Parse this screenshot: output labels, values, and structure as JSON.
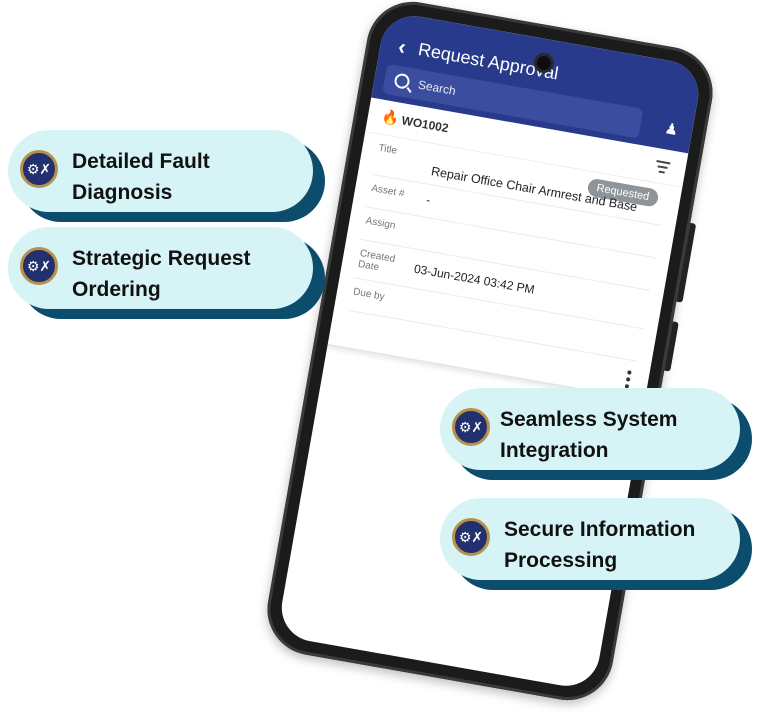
{
  "app": {
    "title": "Request Approval",
    "back_icon": "chevron-left-icon",
    "search_placeholder": "Search",
    "user_icon": "user-approve-icon",
    "filter_icon": "filter-icon"
  },
  "work_order": {
    "priority_icon": "flame-icon",
    "id": "WO1002",
    "status": "Requested",
    "fields": {
      "title_label": "Title",
      "title_value": "Repair Office Chair Armrest and Base",
      "asset_label": "Asset #",
      "asset_value": "-",
      "assign_label": "Assign",
      "assign_value": "",
      "created_label": "Created Date",
      "created_value": "03-Jun-2024 03:42 PM",
      "due_label": "Due by",
      "due_value": ""
    },
    "more_icon": "kebab-menu-icon"
  },
  "features": [
    {
      "label": "Detailed Fault\nDiagnosis",
      "icon": "gear-wrench-icon"
    },
    {
      "label": "Strategic Request\nOrdering",
      "icon": "gear-wrench-icon"
    },
    {
      "label": "Seamless System\nIntegration",
      "icon": "gear-wrench-icon"
    },
    {
      "label": "Secure Information\nProcessing",
      "icon": "gear-wrench-icon"
    }
  ],
  "colors": {
    "appbar": "#283a8c",
    "pill_face": "#d6f4f6",
    "pill_shadow": "#0c4d6e",
    "badge_grey": "#8e9497",
    "icon_navy": "#23306f"
  }
}
